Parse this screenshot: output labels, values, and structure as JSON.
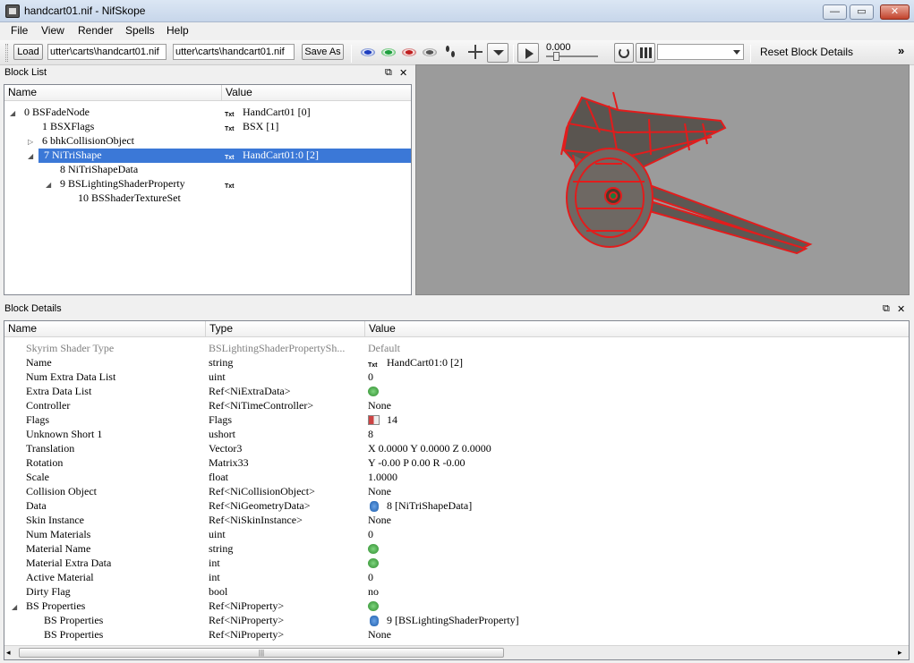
{
  "window": {
    "title": "handcart01.nif - NifSkope",
    "min": "—",
    "max": "▭",
    "close": "✕"
  },
  "menu": [
    "File",
    "View",
    "Render",
    "Spells",
    "Help"
  ],
  "toolbar": {
    "load_label": "Load",
    "load_path": "utter\\carts\\handcart01.nif",
    "save_path": "utter\\carts\\handcart01.nif",
    "save_as_label": "Save As",
    "time_value": "0.000",
    "reset_label": "Reset Block Details",
    "overflow": "»"
  },
  "block_list": {
    "title": "Block List",
    "col_name": "Name",
    "col_value": "Value",
    "rows": [
      {
        "name": "0 BSFadeNode",
        "value": "HandCart01 [0]",
        "txt": "Txt",
        "expander": "◢"
      },
      {
        "name": "1 BSXFlags",
        "value": "BSX [1]",
        "txt": "Txt",
        "expander": ""
      },
      {
        "name": "6 bhkCollisionObject",
        "value": "",
        "txt": "",
        "expander": "▷"
      },
      {
        "name": "7 NiTriShape",
        "value": "HandCart01:0 [2]",
        "txt": "Txt",
        "expander": "◢",
        "selected": true
      },
      {
        "name": "8 NiTriShapeData",
        "value": "",
        "txt": "",
        "expander": ""
      },
      {
        "name": "9 BSLightingShaderProperty",
        "value": "",
        "txt": "Txt",
        "expander": "◢"
      },
      {
        "name": "10 BSShaderTextureSet",
        "value": "",
        "txt": "",
        "expander": ""
      }
    ]
  },
  "block_details": {
    "title": "Block Details",
    "col_name": "Name",
    "col_type": "Type",
    "col_value": "Value",
    "scroll_grip": "|||",
    "rows": [
      {
        "name": "Skyrim Shader Type",
        "type": "BSLightingShaderPropertySh...",
        "value": "Default",
        "icon": "",
        "grey": true
      },
      {
        "name": "Name",
        "type": "string",
        "value": "HandCart01:0 [2]",
        "icon": "txt"
      },
      {
        "name": "Num Extra Data List",
        "type": "uint",
        "value": "0",
        "icon": ""
      },
      {
        "name": "Extra Data List",
        "type": "Ref<NiExtraData>",
        "value": "",
        "icon": "link"
      },
      {
        "name": "Controller",
        "type": "Ref<NiTimeController>",
        "value": "None",
        "icon": ""
      },
      {
        "name": "Flags",
        "type": "Flags",
        "value": "14",
        "icon": "flag"
      },
      {
        "name": "Unknown Short 1",
        "type": "ushort",
        "value": "8",
        "icon": ""
      },
      {
        "name": "Translation",
        "type": "Vector3",
        "value": "X 0.0000 Y 0.0000 Z 0.0000",
        "icon": ""
      },
      {
        "name": "Rotation",
        "type": "Matrix33",
        "value": "Y -0.00 P 0.00 R -0.00",
        "icon": ""
      },
      {
        "name": "Scale",
        "type": "float",
        "value": "1.0000",
        "icon": ""
      },
      {
        "name": "Collision Object",
        "type": "Ref<NiCollisionObject>",
        "value": "None",
        "icon": ""
      },
      {
        "name": "Data",
        "type": "Ref<NiGeometryData>",
        "value": "8 [NiTriShapeData]",
        "icon": "ref"
      },
      {
        "name": "Skin Instance",
        "type": "Ref<NiSkinInstance>",
        "value": "None",
        "icon": ""
      },
      {
        "name": "Num Materials",
        "type": "uint",
        "value": "0",
        "icon": ""
      },
      {
        "name": "Material Name",
        "type": "string",
        "value": "",
        "icon": "link"
      },
      {
        "name": "Material Extra Data",
        "type": "int",
        "value": "",
        "icon": "link"
      },
      {
        "name": "Active Material",
        "type": "int",
        "value": "0",
        "icon": ""
      },
      {
        "name": "Dirty Flag",
        "type": "bool",
        "value": "no",
        "icon": ""
      },
      {
        "name": "BS Properties",
        "type": "Ref<NiProperty>",
        "value": "",
        "icon": "link",
        "expander": "◢"
      },
      {
        "name": "BS Properties",
        "type": "Ref<NiProperty>",
        "value": "9 [BSLightingShaderProperty]",
        "icon": "ref",
        "indent": true
      },
      {
        "name": "BS Properties",
        "type": "Ref<NiProperty>",
        "value": "None",
        "icon": "",
        "indent": true
      }
    ]
  },
  "colors": {
    "selection": "#3b78d7",
    "viewport_bg": "#9b9b9b",
    "wireframe": "#e21c1c"
  }
}
